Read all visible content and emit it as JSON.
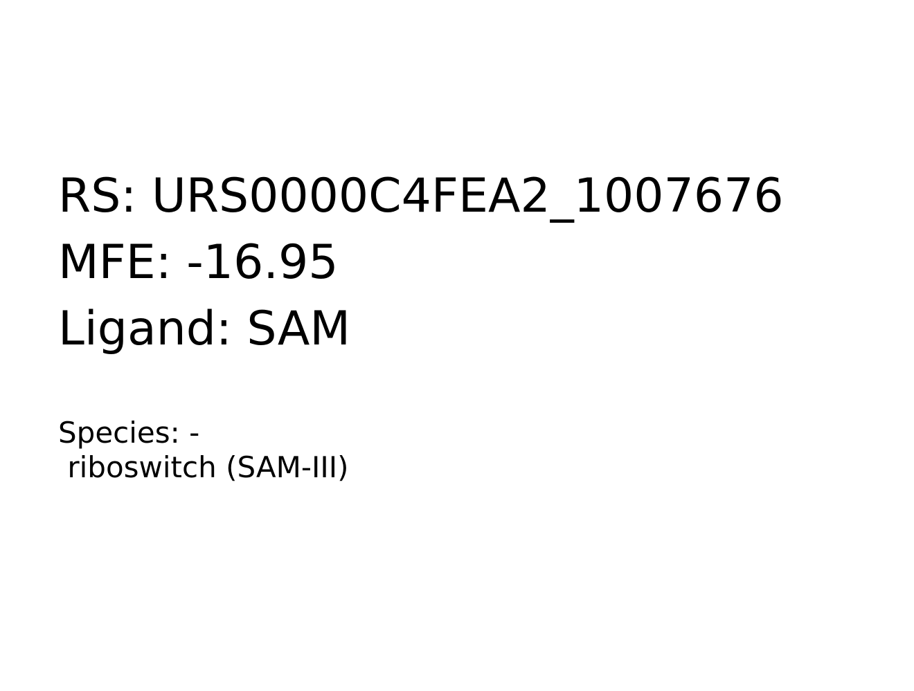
{
  "info": {
    "rs_line": "RS: URS0000C4FEA2_1007676",
    "mfe_line": "MFE: -16.95",
    "ligand_line": "Ligand: SAM",
    "species_line": "Species: -",
    "type_line": " riboswitch (SAM-III)"
  },
  "colors": {
    "background": "#ffffff",
    "text": "#000000"
  }
}
